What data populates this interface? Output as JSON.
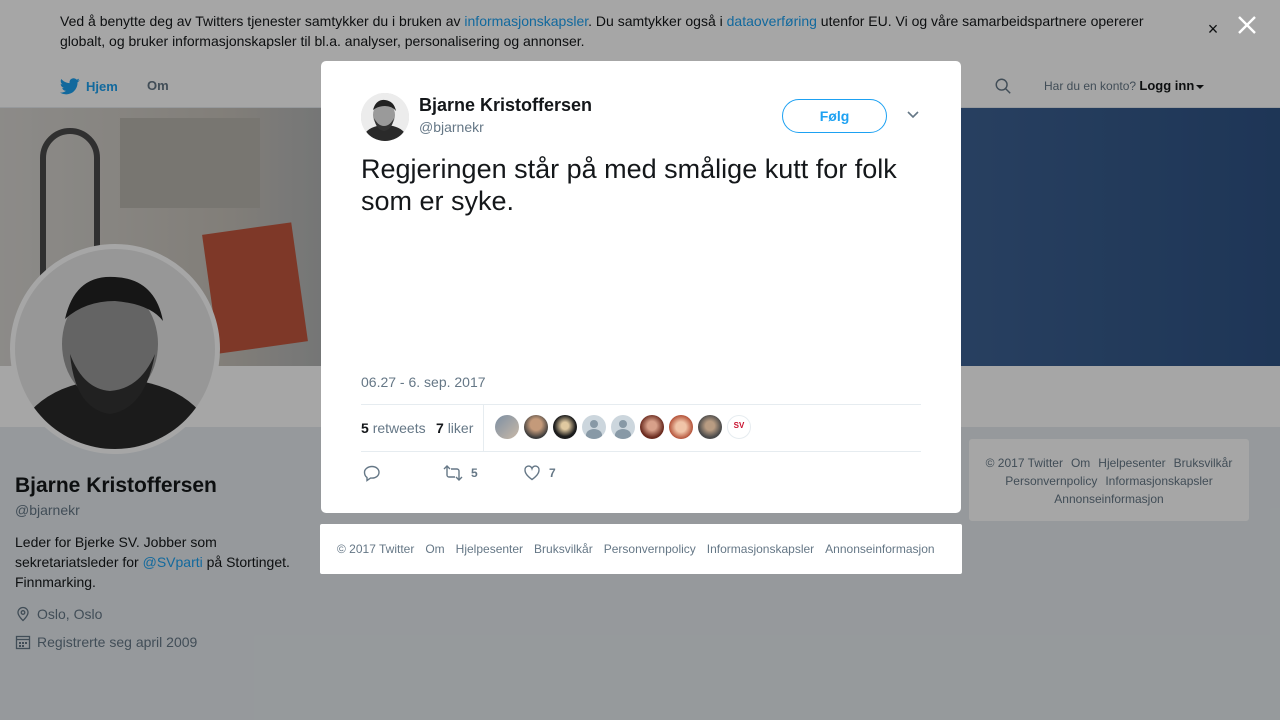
{
  "cookie_banner": {
    "text_1": "Ved å benytte deg av Twitters tjenester samtykker du i bruken av ",
    "link_1": "informasjonskapsler",
    "text_2": ". Du samtykker også i ",
    "link_2": "dataoverføring",
    "text_3": " utenfor EU. Vi og våre samarbeidspartnere opererer globalt, og bruker informasjonskapsler til bl.a. analyser, personalisering og annonser.",
    "close_icon": "close-icon"
  },
  "nav": {
    "home_label": "Hjem",
    "about_label": "Om",
    "account_prompt": "Har du en konto?",
    "login_label": "Logg inn"
  },
  "profile": {
    "name": "Bjarne Kristoffersen",
    "handle": "@bjarnekr",
    "bio_1": "Leder for Bjerke SV. Jobber som sekretariatsleder for ",
    "bio_link": "@SVparti",
    "bio_2": " på Stortinget. Finnmarking.",
    "location": "Oslo, Oslo",
    "joined": "Registrerte seg april 2009"
  },
  "tweet": {
    "author_name": "Bjarne Kristoffersen",
    "author_handle": "@bjarnekr",
    "follow_label": "Følg",
    "text": "Regjeringen står på med smålige kutt for folk som er syke.",
    "timestamp": "06.27 - 6. sep. 2017",
    "retweets_count": "5",
    "retweets_label": "retweets",
    "likes_count": "7",
    "likes_label": "liker",
    "action_retweet_count": "5",
    "action_like_count": "7"
  },
  "footer": {
    "items": [
      "© 2017 Twitter",
      "Om",
      "Hjelpesenter",
      "Bruksvilkår",
      "Personvernpolicy",
      "Informasjonskapsler",
      "Annonseinformasjon"
    ]
  },
  "colors": {
    "accent": "#1da1f2",
    "text": "#14171a",
    "muted": "#657786"
  }
}
